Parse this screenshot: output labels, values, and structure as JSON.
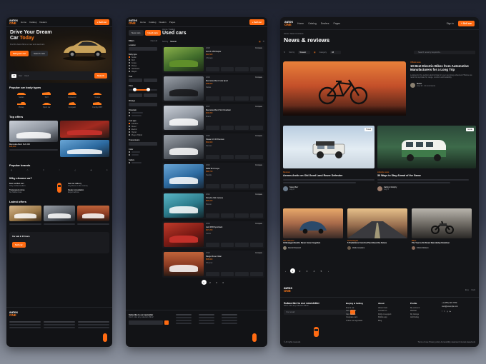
{
  "brand": {
    "logo_top": "autos",
    "logo_bottom": "ONE",
    "accent": "#ff6b12",
    "background": "#121316"
  },
  "home": {
    "nav": {
      "links": [
        "Home",
        "Catalog",
        "Dealers",
        "Pages",
        "News"
      ],
      "signin": "Sign in",
      "cta": "+ Sell car"
    },
    "hero": {
      "title_line1": "Drive Your Dream",
      "title_line2": "Car",
      "title_accent": "Today",
      "subtitle": "Find the best offers on new and used cars",
      "btn_primary": "Sell your car",
      "btn_secondary": "Search cars"
    },
    "search": {
      "tabs": [
        "All",
        "New",
        "Used"
      ],
      "button": "Search"
    },
    "popular_title": "Popular car body types",
    "body_types": [
      "Sedan",
      "SUV",
      "Crossover",
      "Coupe",
      "Pickup",
      "Sport car",
      "Compact",
      "Family MPV"
    ],
    "top_offers_title": "Top offers",
    "listing": {
      "title": "Mercedes-Benz SLK 200",
      "price": "$45,000"
    },
    "brands_title": "Popular brands",
    "why_title": "Why choose us?",
    "why_items": [
      {
        "title": "Best certified cars",
        "desc": "Only verified sellers"
      },
      {
        "title": "Fast car delivery",
        "desc": "Anywhere in the country"
      },
      {
        "title": "Transparent prices",
        "desc": "No hidden fees"
      },
      {
        "title": "Dealer consultation",
        "desc": "Expert advice"
      }
    ],
    "latest_title": "Latest offers",
    "sell_title": "Car sale in 24 hours",
    "sell_button": "Sell car"
  },
  "catalog": {
    "breadcrumb": "Home / Catalog",
    "title": "Used cars",
    "tabs": [
      "New cars",
      "Used cars"
    ],
    "filter_title": "Filters",
    "clear": "Clear all",
    "sort_label": "Sort by",
    "sort_value": "Newest",
    "sections": [
      "Location",
      "Body type",
      "Year",
      "Price",
      "Mileage",
      "Drivetrain",
      "Fuel type",
      "Transmission",
      "Color",
      "Sellers"
    ],
    "body_types": [
      "Sedan",
      "SUV",
      "Coupe",
      "Pickup",
      "Hatchback",
      "Wagon"
    ],
    "fuel_types": [
      "Gasoline",
      "Diesel",
      "Electric",
      "Hybrid",
      "Plug-in Hybrid"
    ],
    "listings": [
      {
        "year": "2018",
        "title": "Ford F-150 Raptor",
        "price": "$41,500",
        "loc": "Chicago"
      },
      {
        "year": "2019",
        "title": "Mercedes-Benz GLE Sport",
        "price": "$38,900",
        "loc": "Dallas"
      },
      {
        "year": "2017",
        "title": "Mercedes-Benz SLK Roadster",
        "price": "$29,300",
        "loc": "Miami"
      },
      {
        "year": "2020",
        "title": "Nissan GT-R Premium",
        "price": "$52,000",
        "loc": "Denver"
      },
      {
        "year": "2016",
        "title": "BMW M4 Coupe",
        "price": "$34,700",
        "loc": "Seattle"
      },
      {
        "year": "2021",
        "title": "Porsche 911 Carrera",
        "price": "$96,400",
        "loc": "Boston"
      },
      {
        "year": "2019",
        "title": "Audi RS5 Sportback",
        "price": "$47,200",
        "loc": "Austin"
      },
      {
        "year": "2022",
        "title": "Range Rover Velar",
        "price": "$58,900",
        "loc": "Phoenix"
      }
    ],
    "spec_labels": [
      "Mileage",
      "Fuel",
      "Gearbox",
      "Engine"
    ],
    "compare": "Compare",
    "pages": [
      "1",
      "2",
      "3",
      "4"
    ]
  },
  "news": {
    "nav_links": [
      "Home",
      "Catalog",
      "Dealers",
      "Pages"
    ],
    "signin": "Sign in",
    "cta": "+ Sell car",
    "breadcrumb": "Home / News & reviews",
    "title": "News & reviews",
    "sort_label": "Sort by",
    "sort_value": "Newest",
    "category_label": "Category",
    "category_value": "All",
    "search_placeholder": "Search news by keywords...",
    "featured": {
      "category": "Official news",
      "title": "10 Best Electric Bikes from Automotive Manufacturers for a Long Trip",
      "excerpt": "Looking for the perfect electric bike for your next long adventure? Below we rank the top bikes for range, comfort and durability.",
      "author": "Martin",
      "date": "July 10",
      "comments": "24 comments"
    },
    "articles": [
      {
        "category": "Reviews",
        "title": "Across Arctic on Old Good Land Rover Defender",
        "author": "Steve Barr",
        "date": "July 8",
        "badge": "Travel"
      },
      {
        "category": "Lifestyle news",
        "title": "30 Ways to Stay Ahead of the Game",
        "author": "Kathryn Murphy",
        "date": "July 5",
        "badge": "Guide"
      }
    ],
    "small_articles": [
      {
        "category": "Car collection",
        "title": "Volkswagen Beetle: Never Gone Forgotten",
        "author": "Darrell Steward"
      },
      {
        "category": "Technologies",
        "title": "5 Predictions from the Past About the Future",
        "author": "Wade Hawkins"
      },
      {
        "category": "Bikes",
        "title": "The Year to All About New Harley Davidson",
        "author": "Kristin Watson"
      }
    ],
    "pages": [
      "1",
      "2",
      "3",
      "4",
      "5"
    ],
    "newsletter": {
      "title": "Subscribe to our newsletter",
      "desc": "Don't miss any relevant offers!",
      "placeholder": "Your email"
    },
    "footer_cols": [
      {
        "title": "Buying & Selling",
        "items": [
          "Find a car",
          "Sell your car",
          "Car dealers",
          "Compare cars",
          "Online car appraisal"
        ]
      },
      {
        "title": "About",
        "items": [
          "About Cars",
          "Contact us",
          "FAQs & support",
          "Mobile app",
          "Blog"
        ]
      },
      {
        "title": "Profile",
        "items": [
          "My account",
          "Wishlist",
          "My listings",
          "Add listing"
        ]
      }
    ],
    "phone": "+1 (555) 220 7780",
    "email": "cars@example.com",
    "copyright": "© All rights reserved.",
    "legal": "Terms of use   Privacy policy   Accessibility statement   Interest-based ads",
    "lang": "Eng",
    "theme": "Dark"
  }
}
